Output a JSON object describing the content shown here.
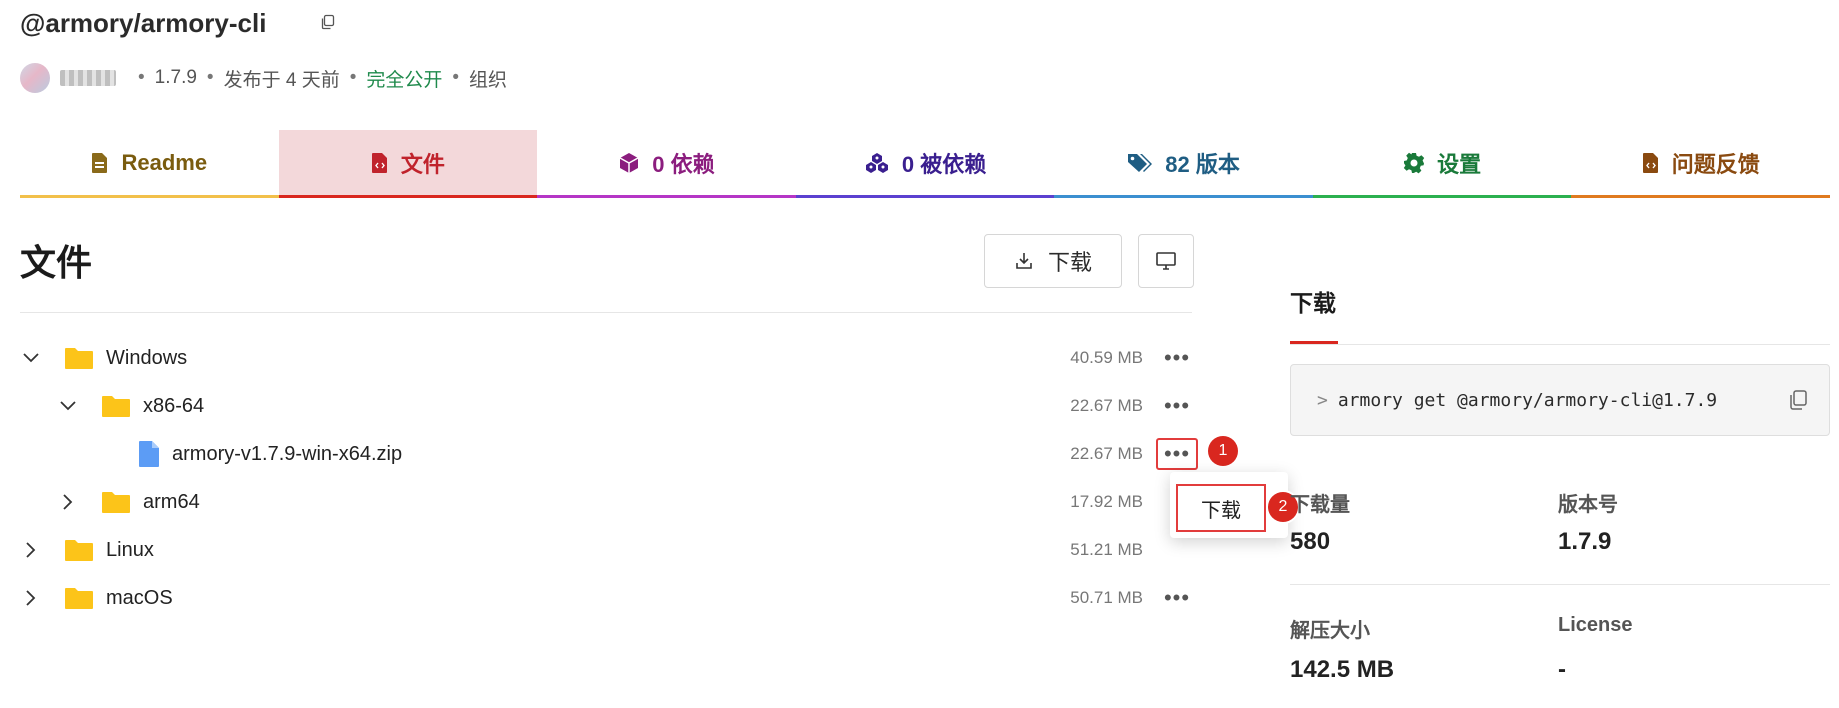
{
  "header": {
    "title": "@armory/armory-cli",
    "version": "1.7.9",
    "published": "发布于 4 天前",
    "visibility": "完全公开",
    "org": "组织",
    "separator": "•"
  },
  "tabs": [
    {
      "label": "Readme",
      "color": "#7a5c0f",
      "bar": "#f2c04a",
      "icon": "readme-icon"
    },
    {
      "label": "文件",
      "color": "#c0232c",
      "bar": "#d9271f",
      "icon": "file-code-icon",
      "active": true
    },
    {
      "label": "0 依赖",
      "color": "#8b1d7e",
      "bar": "#b535c6",
      "icon": "cube-icon"
    },
    {
      "label": "0 被依赖",
      "color": "#3a1f8f",
      "bar": "#5b40d0",
      "icon": "cubes-icon"
    },
    {
      "label": "82 版本",
      "color": "#1f5d83",
      "bar": "#3b8fd0",
      "icon": "tags-icon"
    },
    {
      "label": "设置",
      "color": "#1a7a3a",
      "bar": "#2bb04f",
      "icon": "gear-icon"
    },
    {
      "label": "问题反馈",
      "color": "#8a4a10",
      "bar": "#e07a1f",
      "icon": "issue-icon"
    }
  ],
  "files": {
    "heading": "文件",
    "download_label": "下载",
    "tree": [
      {
        "name": "Windows",
        "size": "40.59 MB",
        "type": "folder",
        "expanded": true
      },
      {
        "name": "x86-64",
        "size": "22.67 MB",
        "type": "folder",
        "expanded": true
      },
      {
        "name": "armory-v1.7.9-win-x64.zip",
        "size": "22.67 MB",
        "type": "file"
      },
      {
        "name": "arm64",
        "size": "17.92 MB",
        "type": "folder",
        "expanded": false
      },
      {
        "name": "Linux",
        "size": "51.21 MB",
        "type": "folder",
        "expanded": false
      },
      {
        "name": "macOS",
        "size": "50.71 MB",
        "type": "folder",
        "expanded": false
      }
    ],
    "more_glyph": "•••",
    "context_menu": {
      "download": "下载"
    },
    "markers": {
      "one": "1",
      "two": "2"
    }
  },
  "sidebar": {
    "heading": "下载",
    "command_prompt": ">",
    "command": "armory get @armory/armory-cli@1.7.9",
    "stats": {
      "downloads_label": "下载量",
      "downloads": "580",
      "version_label": "版本号",
      "version": "1.7.9",
      "unpacked_label": "解压大小",
      "unpacked": "142.5 MB",
      "license_label": "License",
      "license": "-"
    }
  }
}
